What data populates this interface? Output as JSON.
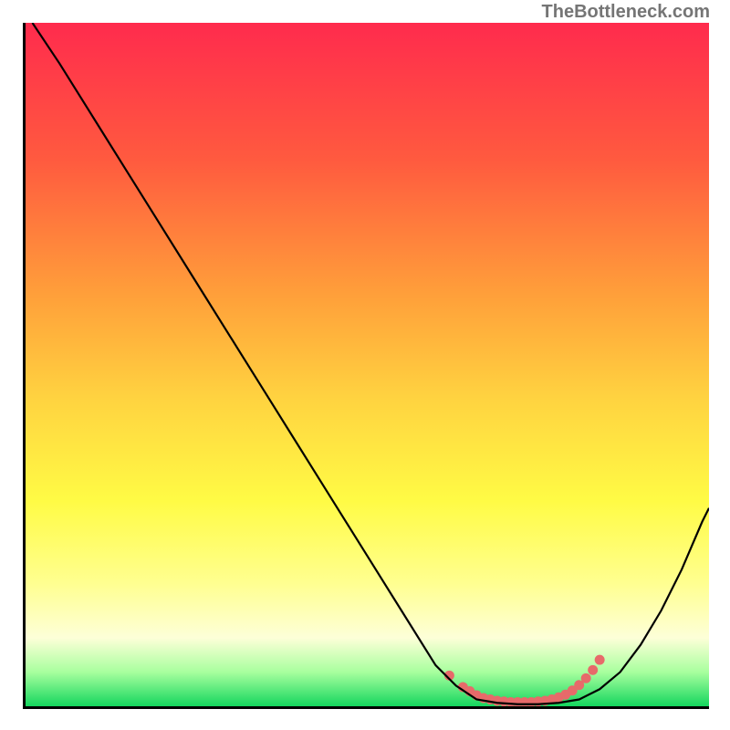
{
  "watermark": "TheBottleneck.com",
  "chart_data": {
    "type": "line",
    "title": "",
    "xlabel": "",
    "ylabel": "",
    "xlim": [
      0,
      100
    ],
    "ylim": [
      0,
      100
    ],
    "gradient_stops": [
      {
        "offset": 0,
        "color": "#ff2b4d"
      },
      {
        "offset": 20,
        "color": "#ff5a3f"
      },
      {
        "offset": 40,
        "color": "#ffa03a"
      },
      {
        "offset": 55,
        "color": "#ffd340"
      },
      {
        "offset": 70,
        "color": "#fffb45"
      },
      {
        "offset": 82,
        "color": "#ffff90"
      },
      {
        "offset": 90,
        "color": "#fdffd8"
      },
      {
        "offset": 95,
        "color": "#a8ff9e"
      },
      {
        "offset": 100,
        "color": "#14d65e"
      }
    ],
    "series": [
      {
        "name": "bottleneck-curve",
        "color": "#000000",
        "x": [
          1,
          5,
          10,
          15,
          20,
          25,
          30,
          35,
          40,
          45,
          50,
          55,
          60,
          63,
          66,
          69,
          72,
          75,
          78,
          81,
          84,
          87,
          90,
          93,
          96,
          99,
          100
        ],
        "y": [
          100,
          94,
          86,
          78,
          70,
          62,
          54,
          46,
          38,
          30,
          22,
          14,
          6,
          3,
          1,
          0.5,
          0.3,
          0.3,
          0.5,
          1,
          2.5,
          5,
          9,
          14,
          20,
          27,
          29
        ]
      },
      {
        "name": "highlight-dots",
        "color": "#e76a6a",
        "type": "scatter",
        "x": [
          62,
          64,
          65,
          66,
          67,
          68,
          69,
          70,
          71,
          72,
          73,
          74,
          75,
          76,
          77,
          78,
          79,
          80,
          81,
          82,
          83,
          84
        ],
        "y": [
          4.5,
          2.8,
          2.2,
          1.6,
          1.2,
          1.0,
          0.8,
          0.7,
          0.6,
          0.6,
          0.6,
          0.6,
          0.7,
          0.8,
          1.0,
          1.3,
          1.7,
          2.3,
          3.1,
          4.1,
          5.3,
          6.8
        ]
      }
    ]
  }
}
